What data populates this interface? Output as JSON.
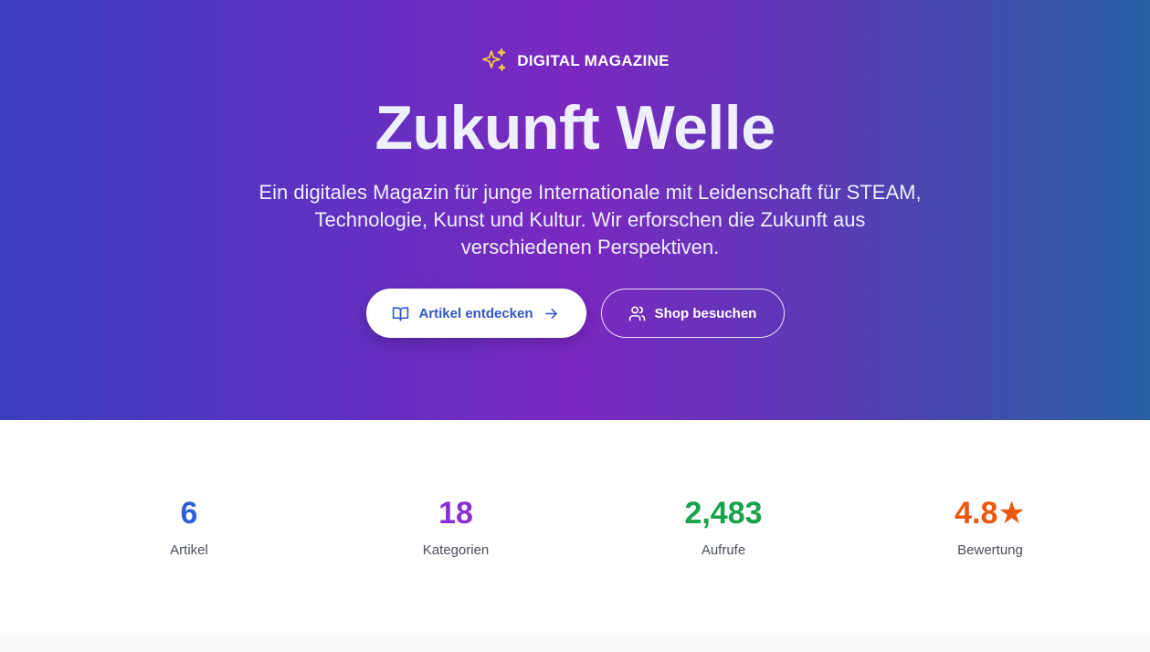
{
  "hero": {
    "badge": "DIGITAL MAGAZINE",
    "badge_icon": "sparkles-icon",
    "title": "Zukunft Welle",
    "subtitle": "Ein digitales Magazin für junge Internationale mit Leidenschaft für STEAM, Technologie, Kunst und Kultur. Wir erforschen die Zukunft aus verschiedenen Perspektiven.",
    "primary_button": {
      "label": "Artikel entdecken",
      "icon": "book-open-icon",
      "trailing_icon": "arrow-right-icon"
    },
    "secondary_button": {
      "label": "Shop besuchen",
      "icon": "users-icon"
    }
  },
  "stats": [
    {
      "value": "6",
      "label": "Artikel",
      "color": "#2f5fd6"
    },
    {
      "value": "18",
      "label": "Kategorien",
      "color": "#8a2fd8"
    },
    {
      "value": "2,483",
      "label": "Aufrufe",
      "color": "#16a34a"
    },
    {
      "value": "4.8★",
      "label": "Bewertung",
      "color": "#ea580c"
    }
  ],
  "colors": {
    "gradient_start": "#3a3fbd",
    "gradient_mid": "#7b28c0",
    "gradient_end": "#2760a3",
    "sparkle": "#f5c842",
    "primary_button_text": "#2f56c9"
  }
}
